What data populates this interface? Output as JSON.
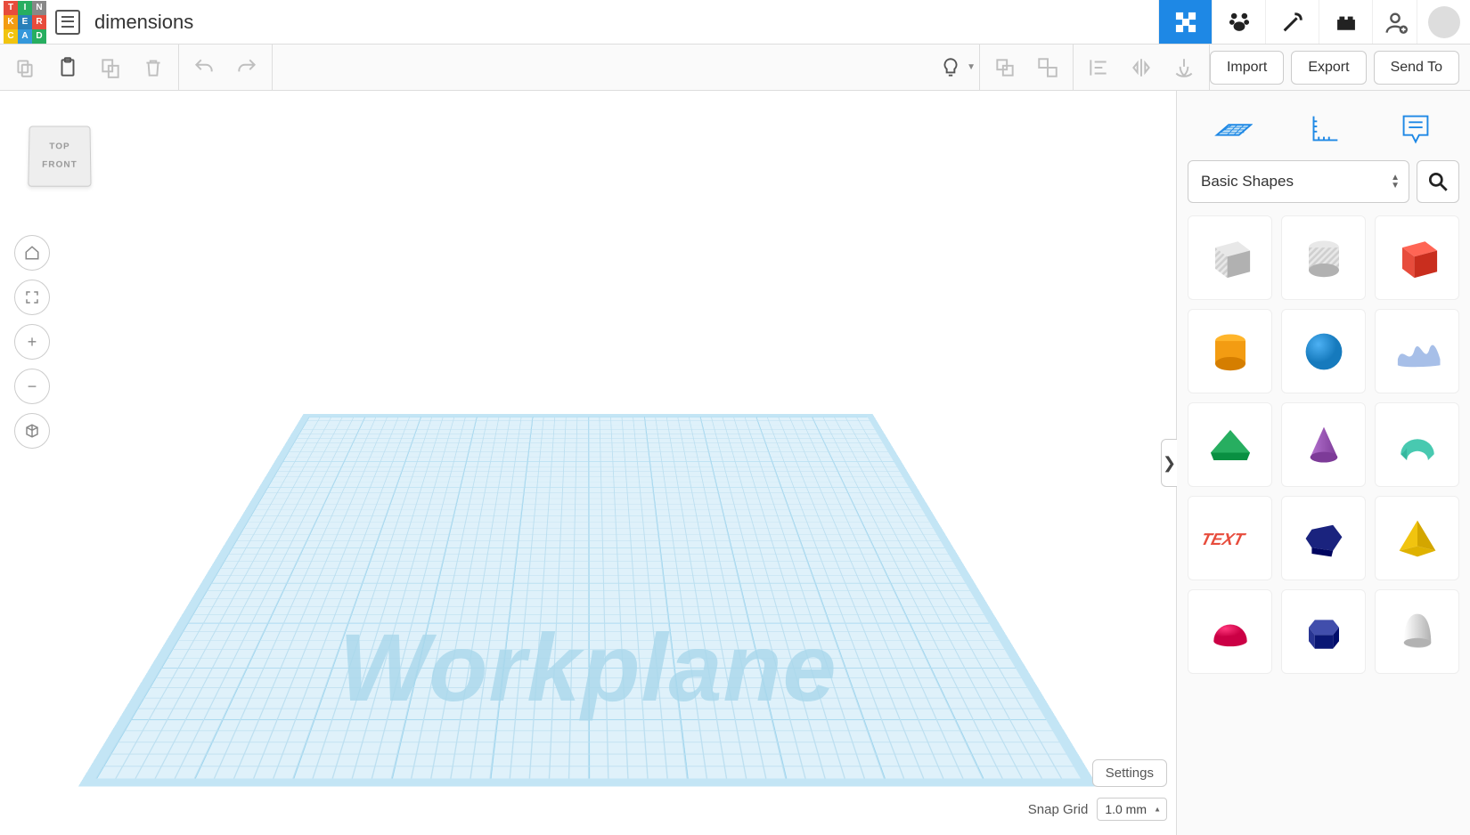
{
  "doc": {
    "title": "dimensions"
  },
  "header": {
    "modes": [
      "3d-design",
      "circuits",
      "codeblocks",
      "bricks"
    ]
  },
  "toolbar": {
    "import": "Import",
    "export": "Export",
    "sendto": "Send To"
  },
  "viewcube": {
    "top": "TOP",
    "front": "FRONT"
  },
  "canvas": {
    "workplane_label": "Workplane",
    "settings": "Settings",
    "snap_label": "Snap Grid",
    "snap_value": "1.0 mm"
  },
  "right_panel": {
    "category": "Basic Shapes",
    "shapes": [
      {
        "name": "box-hole",
        "type": "box",
        "color": "#cfcfcf",
        "striped": true
      },
      {
        "name": "cylinder-hole",
        "type": "cylinder",
        "color": "#cfcfcf",
        "striped": true
      },
      {
        "name": "box-red",
        "type": "box",
        "color": "#e74c3c"
      },
      {
        "name": "cylinder",
        "type": "cylinder",
        "color": "#f39c12"
      },
      {
        "name": "sphere",
        "type": "sphere",
        "color": "#3498db"
      },
      {
        "name": "scribble",
        "type": "scribble",
        "color": "#9db8e6"
      },
      {
        "name": "roof",
        "type": "wedge",
        "color": "#27ae60"
      },
      {
        "name": "cone",
        "type": "cone",
        "color": "#9b59b6"
      },
      {
        "name": "round-roof",
        "type": "halfpipe",
        "color": "#48c9b0"
      },
      {
        "name": "text",
        "type": "text",
        "color": "#e74c3c"
      },
      {
        "name": "polygon",
        "type": "polygon",
        "color": "#1a237e"
      },
      {
        "name": "pyramid",
        "type": "pyramid",
        "color": "#f1c40f"
      },
      {
        "name": "half-sphere",
        "type": "dome",
        "color": "#e91e63"
      },
      {
        "name": "hex-prism",
        "type": "hexprism",
        "color": "#283593"
      },
      {
        "name": "paraboloid",
        "type": "paraboloid",
        "color": "#d0d0d0"
      }
    ]
  }
}
